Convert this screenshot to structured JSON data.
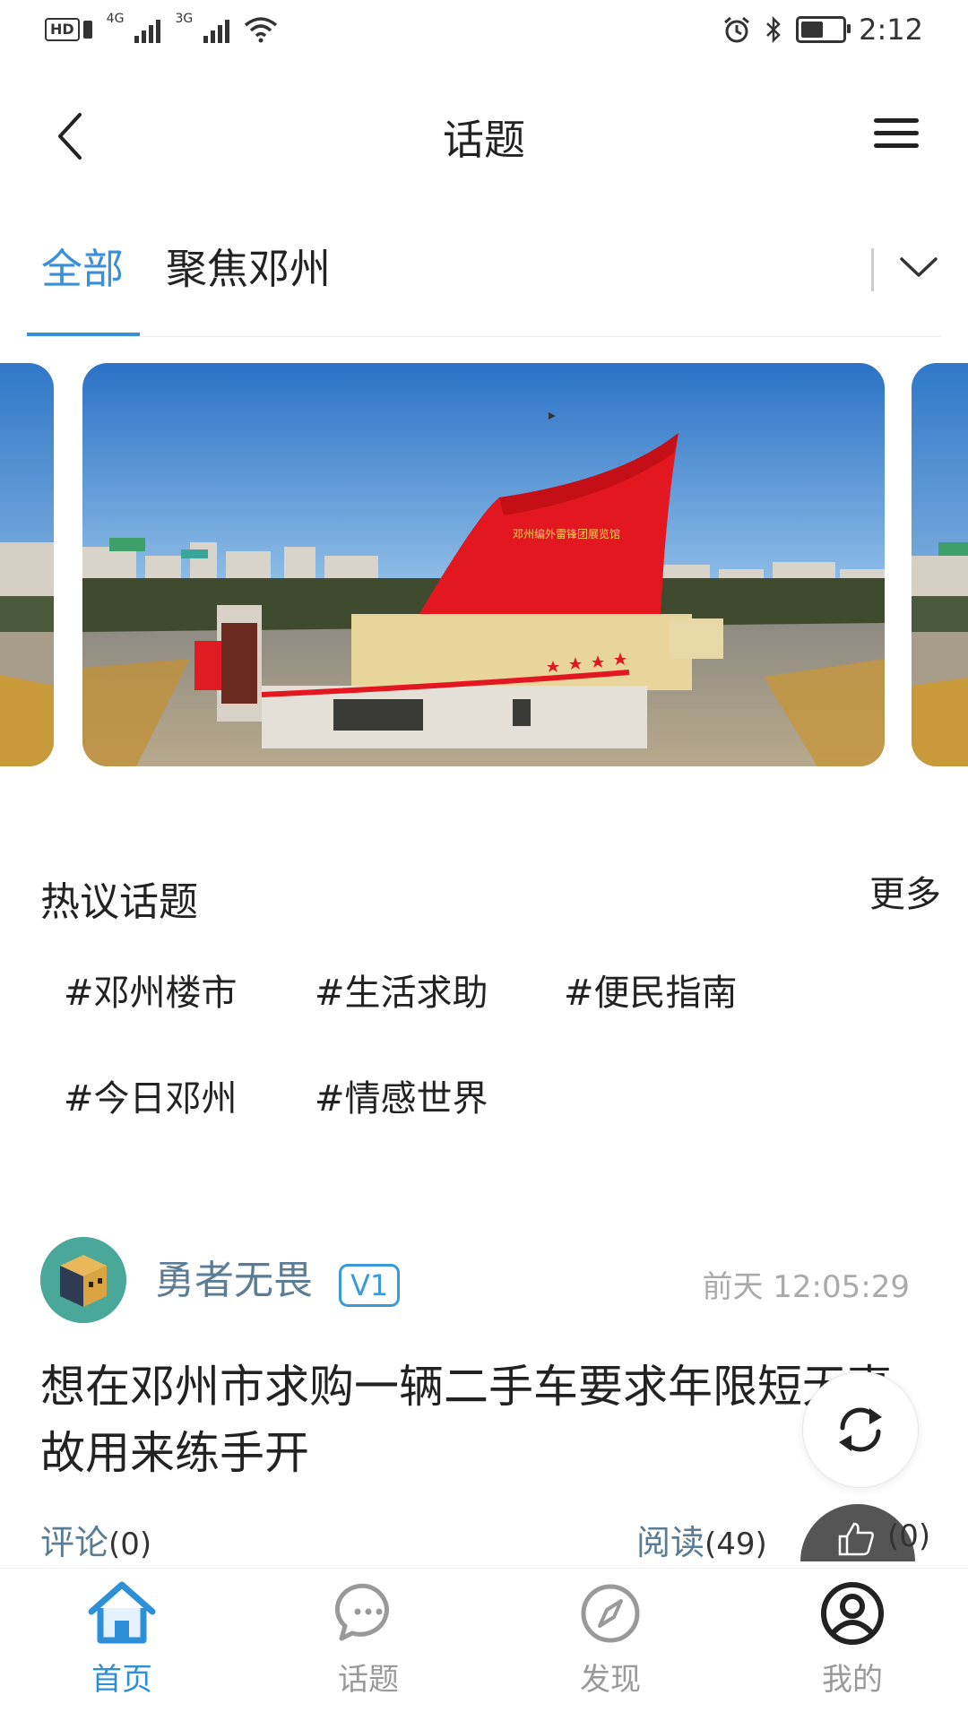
{
  "status_bar": {
    "left_badge": "HD",
    "network_1": "4G",
    "network_2": "3G",
    "time": "2:12",
    "battery_level": 0.55
  },
  "header": {
    "title": "话题"
  },
  "tabs": {
    "items": [
      {
        "label": "全部",
        "active": true
      },
      {
        "label": "聚焦邓州",
        "active": false
      }
    ]
  },
  "carousel": {
    "banner_text": "邓州编外雷锋团展览馆",
    "slides_visible": 3
  },
  "hot_topics": {
    "title": "热议话题",
    "more_label": "更多",
    "tags": [
      "#邓州楼市",
      "#生活求助",
      "#便民指南",
      "#今日邓州",
      "#情感世界"
    ]
  },
  "post": {
    "author": "勇者无畏",
    "level": "V1",
    "time": "前天 12:05:29",
    "title": "想在邓州市求购一辆二手车要求年限短无事故用来练手开",
    "comment_label": "评论",
    "comment_count": "(0)",
    "read_label": "阅读",
    "read_count": "(49)",
    "like_count": "(0)"
  },
  "bottom_nav": {
    "items": [
      {
        "label": "首页",
        "icon": "home-icon",
        "active": true
      },
      {
        "label": "话题",
        "icon": "chat-icon",
        "active": false
      },
      {
        "label": "发现",
        "icon": "compass-icon",
        "active": false
      },
      {
        "label": "我的",
        "icon": "profile-icon",
        "active": false
      }
    ]
  },
  "colors": {
    "accent": "#3a8fd6",
    "author": "#5b7c95",
    "muted": "#aaaaaa"
  }
}
